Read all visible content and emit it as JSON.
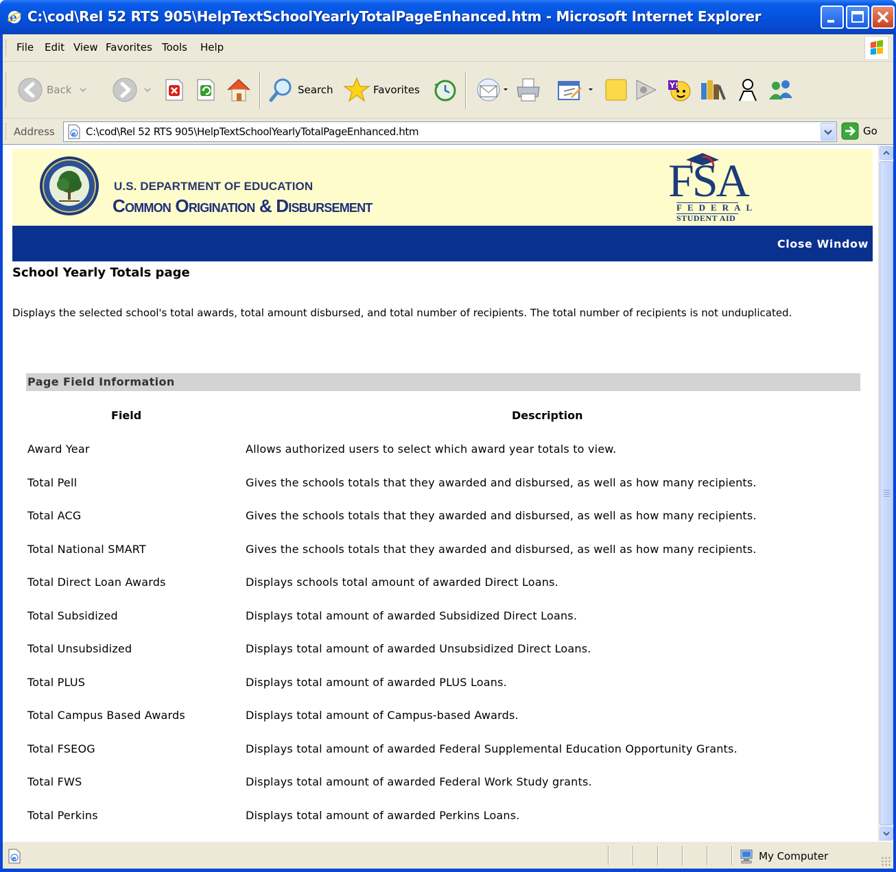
{
  "window": {
    "title": "C:\\cod\\Rel 52 RTS 905\\HelpTextSchoolYearlyTotalPageEnhanced.htm - Microsoft Internet Explorer"
  },
  "menu": [
    "File",
    "Edit",
    "View",
    "Favorites",
    "Tools",
    "Help"
  ],
  "toolbar": {
    "back": "Back",
    "search": "Search",
    "favorites": "Favorites"
  },
  "address": {
    "label": "Address",
    "url": "C:\\cod\\Rel 52 RTS 905\\HelpTextSchoolYearlyTotalPageEnhanced.htm",
    "go": "Go"
  },
  "banner": {
    "dept": "U.S. DEPARTMENT OF EDUCATION",
    "system": "Common Origination & Disbursement",
    "logo_text": "FSA",
    "logo_sub1": "FEDERAL",
    "logo_sub2": "STUDENT AID"
  },
  "nav": {
    "close": "Close Window"
  },
  "page": {
    "title": "School Yearly Totals page",
    "description": "Displays the selected school's total awards, total amount disbursed, and total number of recipients. The total number of recipients is not unduplicated.",
    "section": "Page Field Information",
    "col_field": "Field",
    "col_description": "Description",
    "rows": [
      {
        "field": "Award Year",
        "description": "Allows authorized users to select which award year totals to view."
      },
      {
        "field": "Total Pell",
        "description": "Gives the schools totals that they awarded and disbursed, as well as how many recipients."
      },
      {
        "field": "Total ACG",
        "description": "Gives the schools totals that they awarded and disbursed, as well as how many recipients."
      },
      {
        "field": "Total National SMART",
        "description": "Gives the schools totals that they awarded and disbursed, as well as how many recipients."
      },
      {
        "field": "Total Direct Loan Awards",
        "description": "Displays schools total amount of awarded Direct Loans."
      },
      {
        "field": "Total Subsidized",
        "description": "Displays total amount of awarded Subsidized Direct Loans."
      },
      {
        "field": "Total Unsubsidized",
        "description": "Displays total amount of awarded Unsubsidized Direct Loans."
      },
      {
        "field": "Total PLUS",
        "description": "Displays total amount of awarded PLUS Loans."
      },
      {
        "field": "Total Campus Based Awards",
        "description": "Displays total amount of Campus-based Awards."
      },
      {
        "field": "Total FSEOG",
        "description": "Displays total amount of awarded Federal Supplemental Education Opportunity Grants."
      },
      {
        "field": "Total FWS",
        "description": "Displays total amount of awarded Federal Work Study grants."
      },
      {
        "field": "Total Perkins",
        "description": "Displays total amount of awarded Perkins Loans."
      }
    ]
  },
  "status": {
    "zone": "My Computer"
  },
  "colors": {
    "banner_bg": "#fffccb",
    "nav_bg": "#0b318f",
    "section_bg": "#d3d3d3",
    "titlebar": "#0552dd"
  },
  "icons": [
    "ie-icon",
    "minimize-icon",
    "maximize-icon",
    "close-icon",
    "windows-flag-icon",
    "back-icon",
    "forward-icon",
    "stop-icon",
    "refresh-icon",
    "home-icon",
    "search-icon",
    "favorites-star-icon",
    "history-icon",
    "mail-icon",
    "print-icon",
    "edit-icon",
    "notes-icon",
    "messenger-icon",
    "yahoo-icon",
    "research-icon",
    "people-icon",
    "users-icon",
    "page-icon",
    "go-arrow-icon",
    "my-computer-icon"
  ]
}
